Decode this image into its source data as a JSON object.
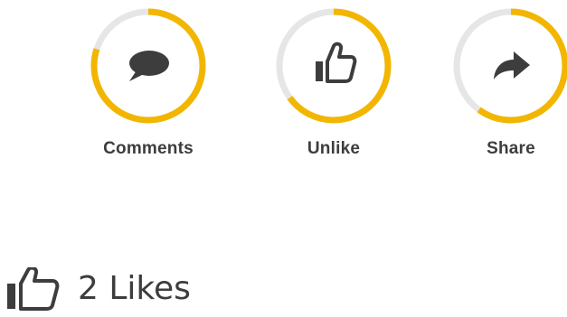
{
  "ring_color": "#f2b600",
  "ring_track_color": "#e6e6e6",
  "actions": [
    {
      "label": "Comments",
      "icon": "comment-icon",
      "progress": 0.8
    },
    {
      "label": "Unlike",
      "icon": "thumbs-up-icon",
      "progress": 0.65
    },
    {
      "label": "Share",
      "icon": "share-arrow-icon",
      "progress": 0.6
    }
  ],
  "likes": {
    "icon": "thumbs-up-icon",
    "text": "2 Likes"
  }
}
